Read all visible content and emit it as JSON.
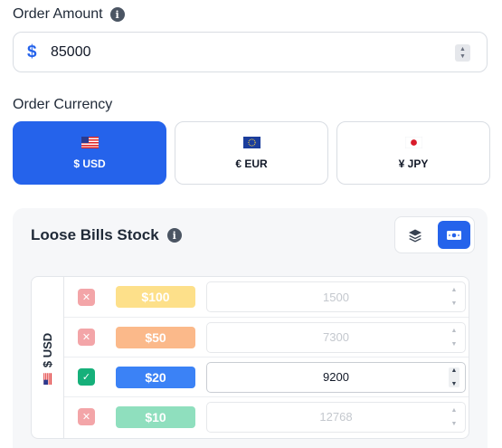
{
  "order_amount": {
    "label": "Order Amount",
    "currency_symbol": "$",
    "value": "85000"
  },
  "order_currency": {
    "label": "Order Currency",
    "options": [
      {
        "label": "$ USD",
        "flag": "us-flag-icon",
        "selected": true
      },
      {
        "label": "€ EUR",
        "flag": "eu-flag-icon",
        "selected": false
      },
      {
        "label": "¥ JPY",
        "flag": "jp-flag-icon",
        "selected": false
      }
    ]
  },
  "stock": {
    "title": "Loose Bills Stock",
    "side_label": "$ USD",
    "view_modes": [
      "layers-icon",
      "banknote-icon"
    ],
    "active_view": "banknote-icon",
    "bills": [
      {
        "denomination": "$100",
        "quantity": "1500",
        "enabled": false,
        "color": "#fde08a"
      },
      {
        "denomination": "$50",
        "quantity": "7300",
        "enabled": false,
        "color": "#fbb98a"
      },
      {
        "denomination": "$20",
        "quantity": "9200",
        "enabled": true,
        "color": "#3b82f6"
      },
      {
        "denomination": "$10",
        "quantity": "12768",
        "enabled": false,
        "color": "#8fdfbe"
      }
    ]
  },
  "colors": {
    "accent": "#2563eb",
    "enabled_check": "#16b07a",
    "disabled_check": "#f3a5a8"
  }
}
